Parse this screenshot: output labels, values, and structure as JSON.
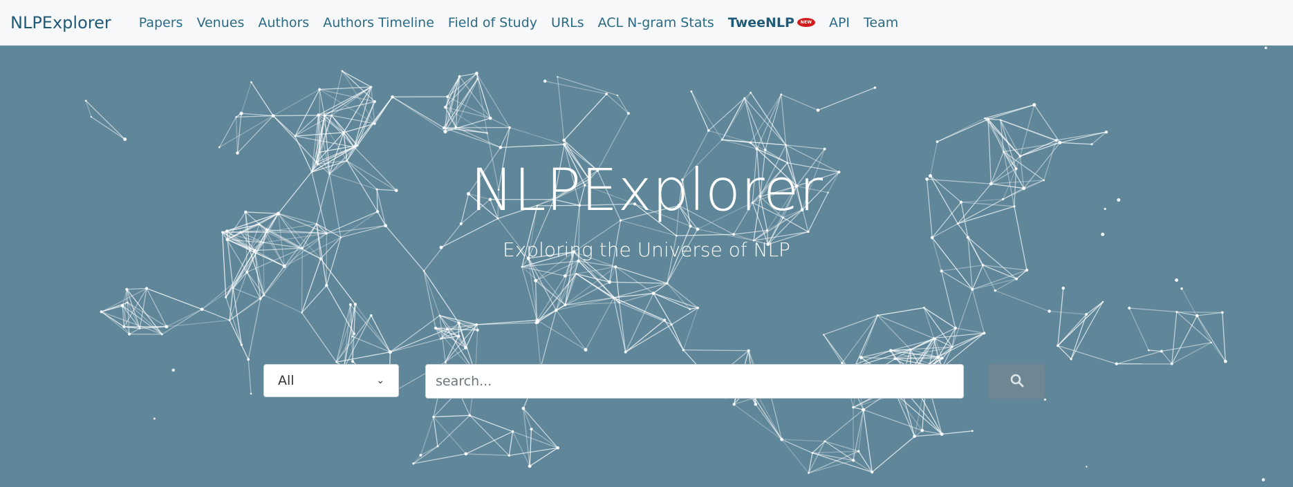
{
  "navbar": {
    "brand": "NLPExplorer",
    "items": [
      {
        "label": "Papers"
      },
      {
        "label": "Venues"
      },
      {
        "label": "Authors"
      },
      {
        "label": "Authors Timeline"
      },
      {
        "label": "Field of Study"
      },
      {
        "label": "URLs"
      },
      {
        "label": "ACL N-gram Stats"
      },
      {
        "label": "TweeNLP",
        "badge": "NEW"
      },
      {
        "label": "API"
      },
      {
        "label": "Team"
      }
    ]
  },
  "hero": {
    "title": "NLPExplorer",
    "subtitle": "Exploring the Universe of NLP"
  },
  "search": {
    "category_selected": "All",
    "placeholder": "search...",
    "button_icon": "search-icon"
  },
  "colors": {
    "hero_background": "#5f8799",
    "navbar_background": "#f7f8fa",
    "brand_text": "#1f5b76",
    "nav_text": "#2a6a84",
    "badge": "#d11a1a",
    "search_button": "#6e8792"
  }
}
